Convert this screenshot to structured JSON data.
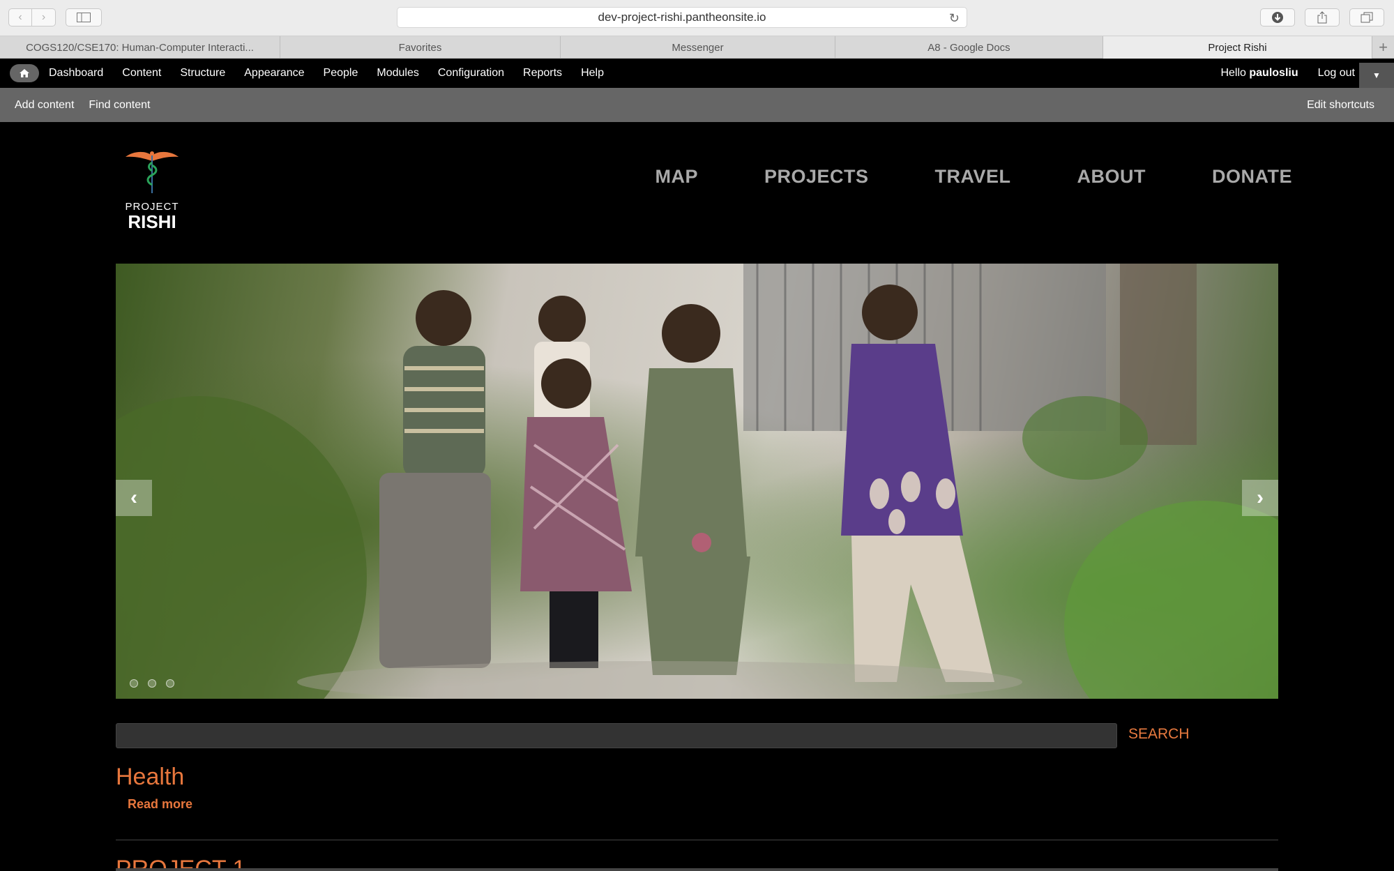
{
  "browser": {
    "url": "dev-project-rishi.pantheonsite.io",
    "tabs": [
      {
        "label": "COGS120/CSE170: Human-Computer Interacti..."
      },
      {
        "label": "Favorites"
      },
      {
        "label": "Messenger"
      },
      {
        "label": "A8 - Google Docs"
      },
      {
        "label": "Project Rishi"
      }
    ]
  },
  "admin": {
    "menu": [
      "Dashboard",
      "Content",
      "Structure",
      "Appearance",
      "People",
      "Modules",
      "Configuration",
      "Reports",
      "Help"
    ],
    "hello": "Hello",
    "user": "paulosliu",
    "logout": "Log out"
  },
  "shortcuts": {
    "add": "Add content",
    "find": "Find content",
    "edit": "Edit shortcuts"
  },
  "site": {
    "logo_line1": "PROJECT",
    "logo_line2": "RISHI",
    "nav": [
      "MAP",
      "PROJECTS",
      "TRAVEL",
      "ABOUT",
      "DONATE"
    ]
  },
  "slider": {
    "slide_count": 3,
    "active_slide": 1
  },
  "search": {
    "value": "",
    "button": "SEARCH"
  },
  "content": {
    "section_title": "Health",
    "read_more": "Read more",
    "project_title": "PROJECT 1"
  },
  "colors": {
    "accent": "#e8773d",
    "admin_bar": "#000000",
    "shortcut_bar": "#666666"
  }
}
